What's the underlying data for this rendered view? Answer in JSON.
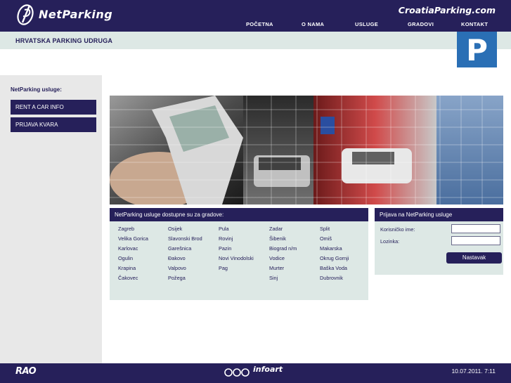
{
  "header": {
    "brand": "NetParking",
    "site_name": "CroatiaParking.com",
    "nav": [
      "POČETNA",
      "O NAMA",
      "USLUGE",
      "GRADOVI",
      "KONTAKT"
    ]
  },
  "subheader": {
    "title": "HRVATSKA PARKING UDRUGA",
    "sign_letter": "P"
  },
  "sidebar": {
    "title": "NetParking usluge:",
    "buttons": [
      "RENT A CAR INFO",
      "PRIJAVA KVARA"
    ]
  },
  "cities": {
    "heading": "NetParking usluge dostupne su za gradove:",
    "columns": [
      [
        "Zagreb",
        "Velika Gorica",
        "Karlovac",
        "Ogulin",
        "Krapina",
        "Čakovec"
      ],
      [
        "Osijek",
        "Slavonski Brod",
        "Garešnica",
        "Đakovo",
        "Valpovo",
        "Požega"
      ],
      [
        "Pula",
        "Rovinj",
        "Pazin",
        "Novi Vinodolski",
        "Pag"
      ],
      [
        "Zadar",
        "Šibenik",
        "Biograd n/m",
        "Vodice",
        "Murter",
        "Sinj"
      ],
      [
        "Split",
        "Omiš",
        "Makarska",
        "Okrug Gornji",
        "Baška Voda",
        "Dubrovnik"
      ]
    ]
  },
  "login": {
    "heading": "Prijava na NetParking usluge",
    "username_label": "Korisničko ime:",
    "username_value": "",
    "password_label": "Lozinka:",
    "password_value": "",
    "submit_label": "Nastavak"
  },
  "footer": {
    "left_logo": "RAO",
    "center_logo": "infoart",
    "datetime": "10.07.2011. 7:11"
  },
  "colors": {
    "primary": "#26205a",
    "light_bg": "#dde8e5",
    "sidebar_bg": "#e8e8e8",
    "sign_blue": "#2a6fb5"
  }
}
